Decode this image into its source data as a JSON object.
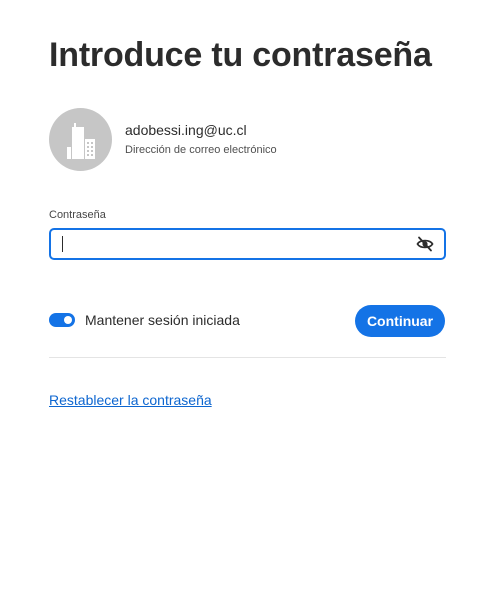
{
  "header": {
    "title": "Introduce tu contraseña"
  },
  "account": {
    "email": "adobessi.ing@uc.cl",
    "email_caption": "Dirección de correo electrónico",
    "avatar_icon": "building-icon"
  },
  "password": {
    "label": "Contraseña",
    "value": "",
    "placeholder": "",
    "visibility_icon": "eye-slash-icon"
  },
  "keep_signed_in": {
    "label": "Mantener sesión iniciada",
    "enabled": true
  },
  "actions": {
    "continue_label": "Continuar"
  },
  "links": {
    "reset_password": "Restablecer la contraseña"
  },
  "colors": {
    "accent": "#1473e6",
    "link": "#0d66d0",
    "avatar_bg": "#c6c6c6"
  }
}
